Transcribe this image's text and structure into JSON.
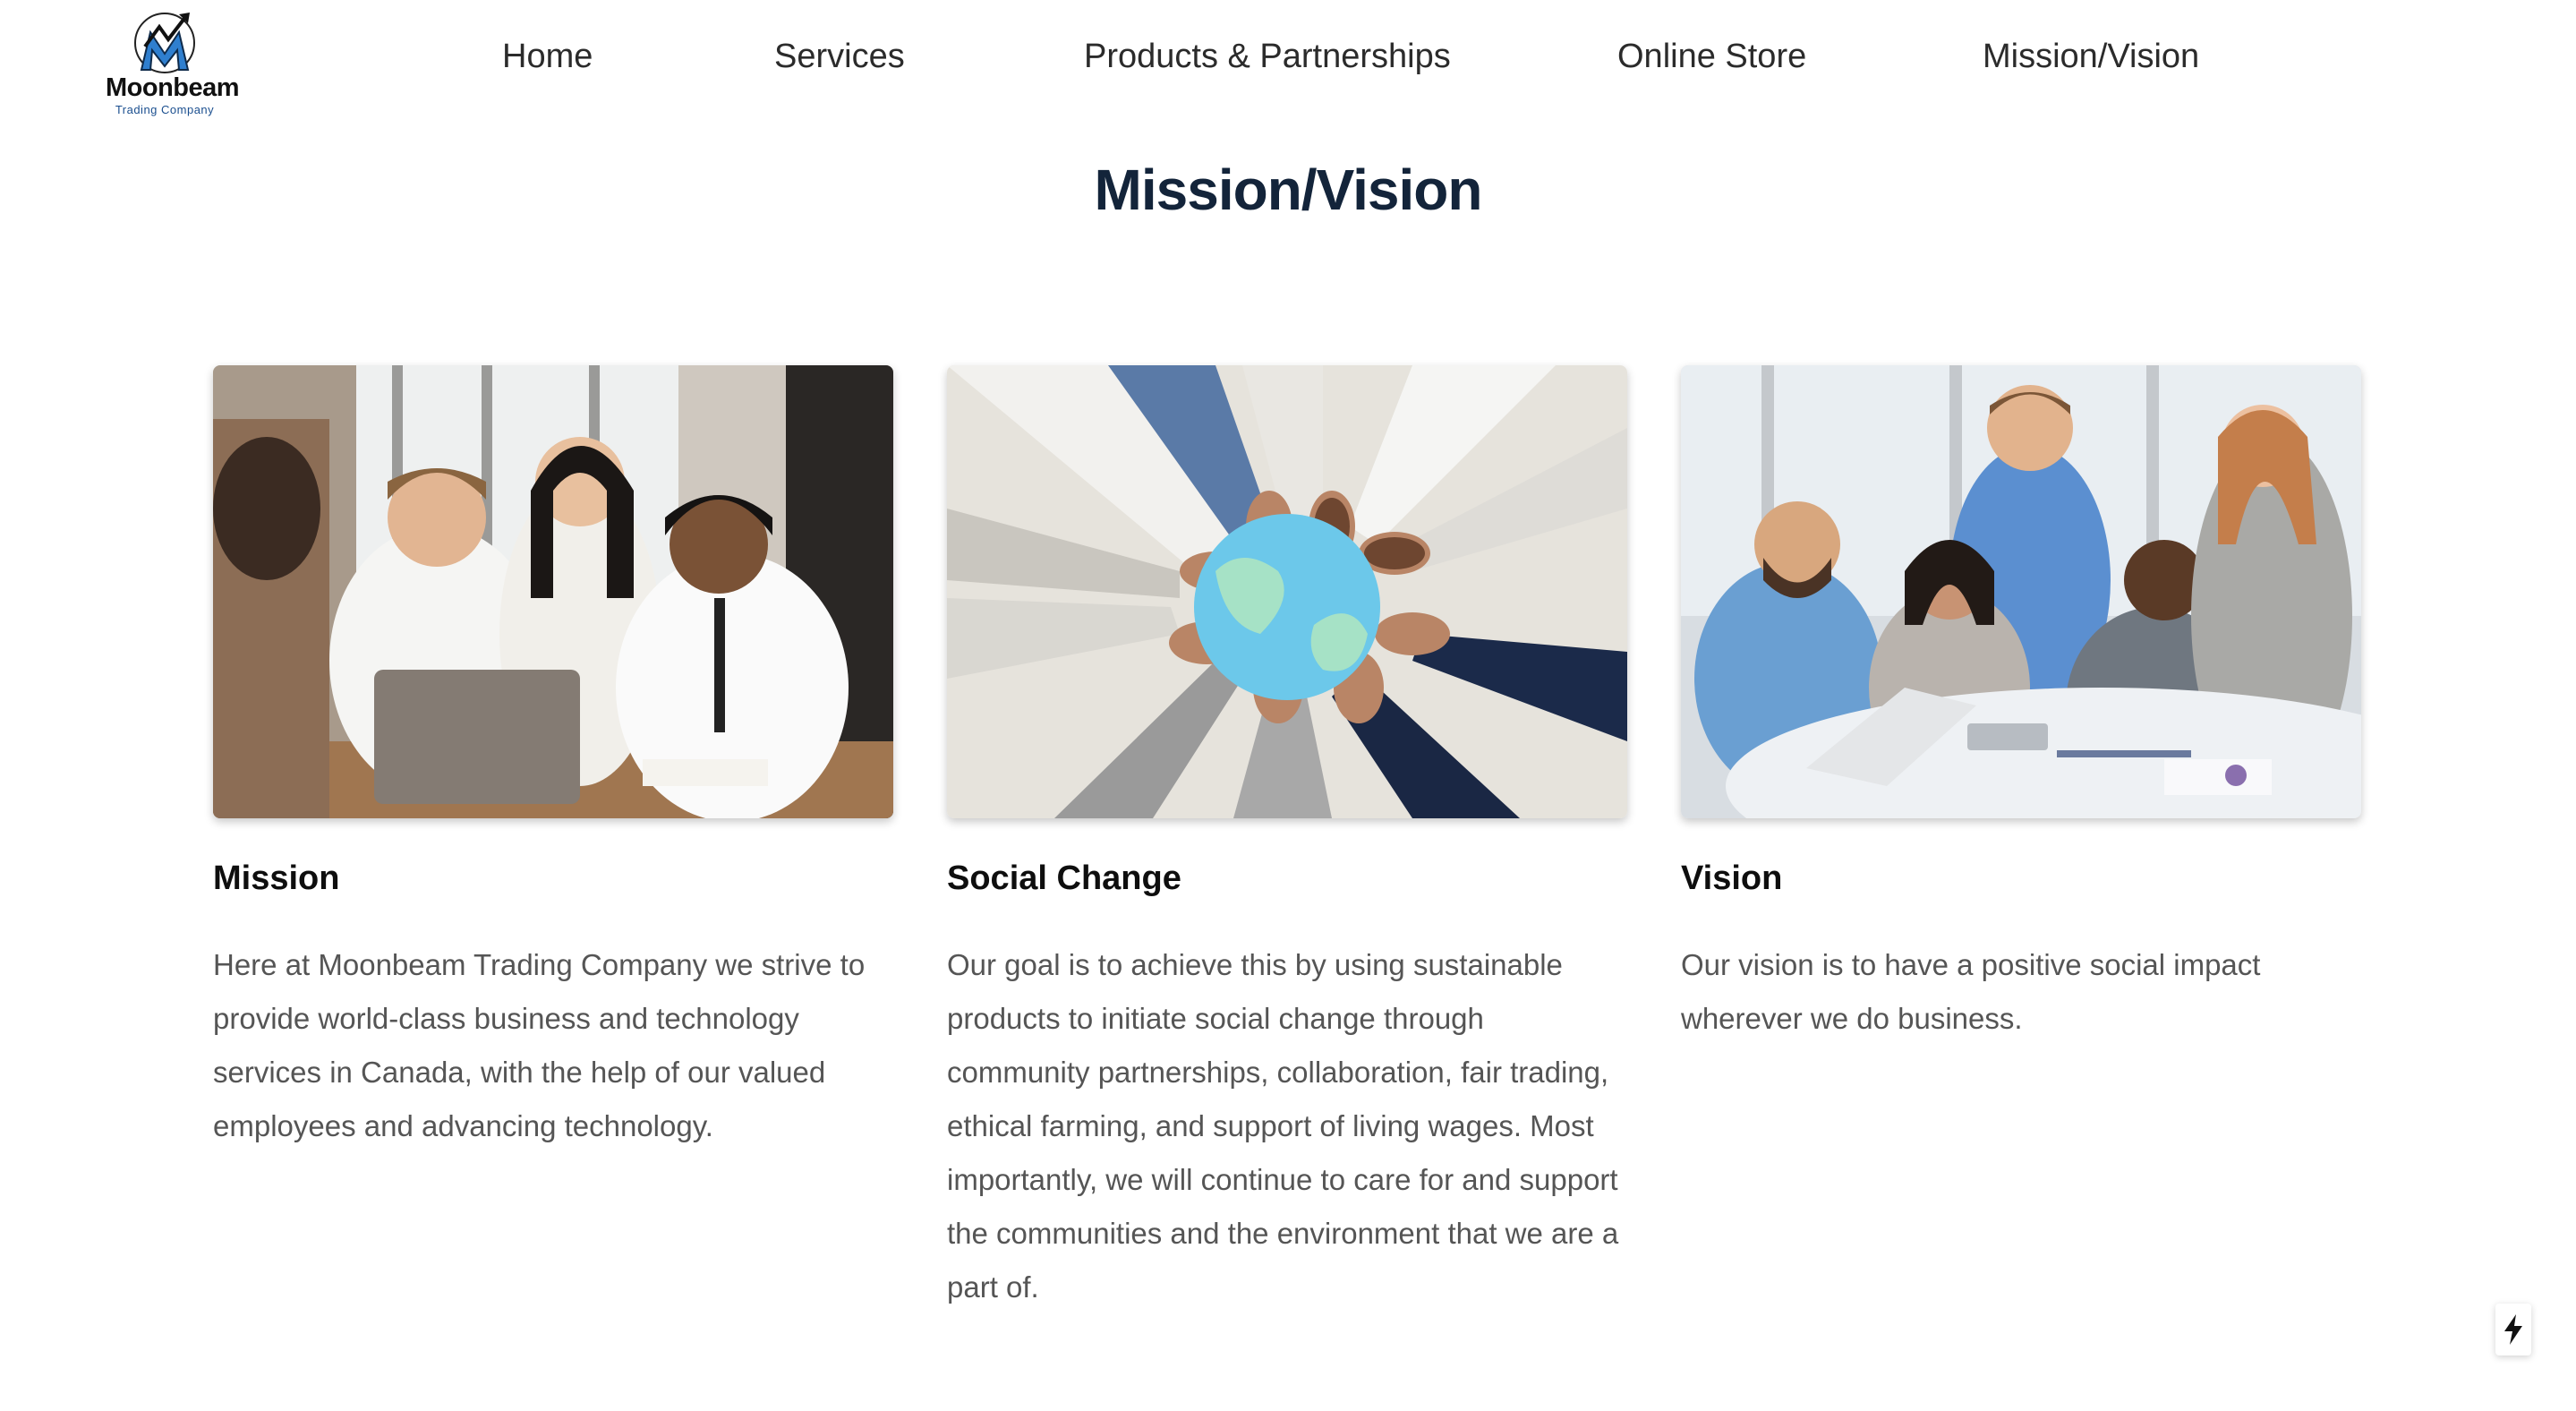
{
  "brand": {
    "name": "Moonbeam",
    "tagline": "Trading Company",
    "logo_icon": "mountain-arrow-logo-icon",
    "accent": "#2f7fcf"
  },
  "nav": {
    "items": [
      {
        "label": "Home"
      },
      {
        "label": "Services"
      },
      {
        "label": "Products & Partnerships"
      },
      {
        "label": "Online Store"
      },
      {
        "label": "Mission/Vision"
      }
    ]
  },
  "page": {
    "title": "Mission/Vision"
  },
  "cards": [
    {
      "title": "Mission",
      "image": "team-meeting-laptop-photo",
      "body": "Here at Moonbeam Trading Company we strive to provide world-class business and technology services in Canada, with the help of our valued employees and advancing technology."
    },
    {
      "title": "Social Change",
      "image": "hands-holding-globe-photo",
      "body": "Our goal is to achieve this by using sustainable products to initiate social change through community partnerships, collaboration, fair trading, ethical farming, and support of living wages. Most importantly, we will continue to care for and support the communities and the environment that we are a part of."
    },
    {
      "title": "Vision",
      "image": "diverse-team-office-photo",
      "body": "Our vision is to have a positive social impact wherever we do business."
    }
  ],
  "widgets": {
    "corner_icon": "lightning-bolt-icon"
  },
  "colors": {
    "title": "#13243a",
    "body_text": "#555555",
    "nav_text": "#2b2b2b"
  }
}
